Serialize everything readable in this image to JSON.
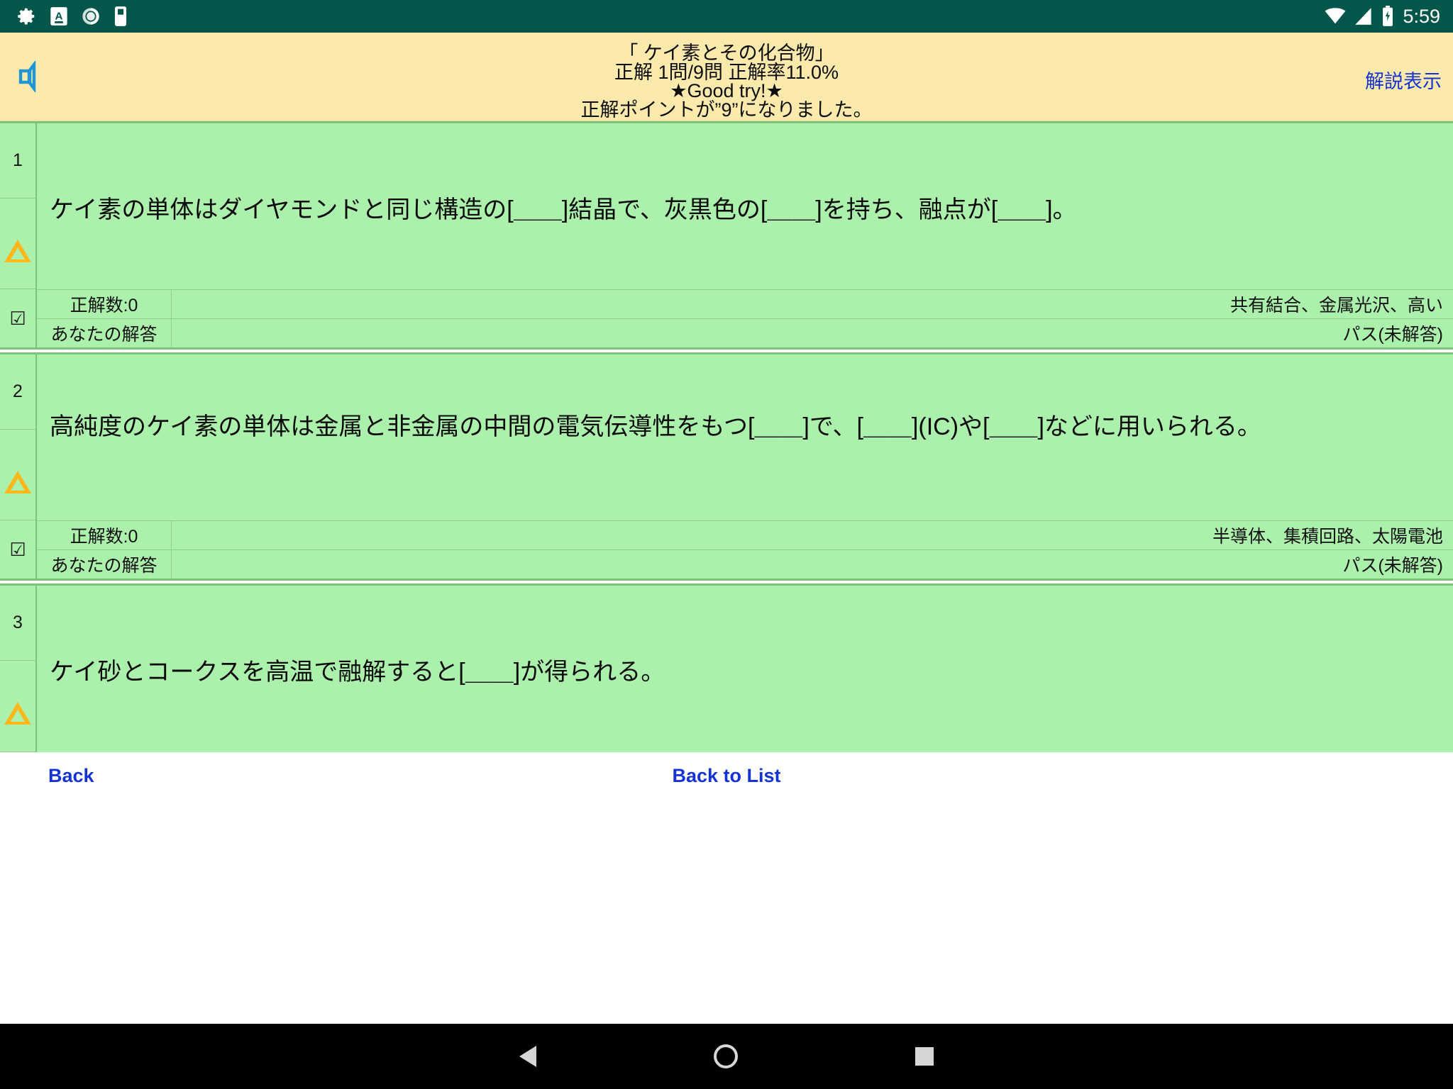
{
  "statusbar": {
    "icons": [
      "gear-icon",
      "a-badge-icon",
      "spinner-icon",
      "sim-card-icon"
    ],
    "right_icons": [
      "wifi-icon",
      "signal-icon",
      "battery-icon"
    ],
    "clock": "5:59",
    "bg_color": "#04564b"
  },
  "header": {
    "speaker_icon": "speaker-mute-icon",
    "title": "「 ケイ素とその化合物」",
    "score_line": "正解 1問/9問  正解率11.0%",
    "encourage_line": "★Good try!★",
    "point_line": "正解ポイントが”9”になりました。",
    "explain_link": "解説表示",
    "bg_color": "#fbeaac",
    "link_color": "#1433d6"
  },
  "questions": [
    {
      "number": "1",
      "mark_icon": "triangle-warning-icon",
      "check_icon": "checkbox-checked-icon",
      "text": "ケイ素の単体はダイヤモンドと同じ構造の[＿＿]結晶で、灰黒色の[＿＿]を持ち、融点が[＿＿]。",
      "correct_count_label": "正解数:0",
      "correct_answer": "共有結合、金属光沢、高い",
      "your_answer_label": "あなたの解答",
      "your_answer": "パス(未解答)"
    },
    {
      "number": "2",
      "mark_icon": "triangle-warning-icon",
      "check_icon": "checkbox-checked-icon",
      "text": "高純度のケイ素の単体は金属と非金属の中間の電気伝導性をもつ[＿＿]で、[＿＿](IC)や[＿＿]などに用いられる。",
      "correct_count_label": "正解数:0",
      "correct_answer": "半導体、集積回路、太陽電池",
      "your_answer_label": "あなたの解答",
      "your_answer": "パス(未解答)"
    },
    {
      "number": "3",
      "mark_icon": "triangle-warning-icon",
      "text": "ケイ砂とコークスを高温で融解すると[＿＿]が得られる。"
    }
  ],
  "footer": {
    "back_label": "Back",
    "back_to_list_label": "Back to List"
  },
  "navbar": {
    "back_icon": "nav-back-triangle-icon",
    "home_icon": "nav-home-circle-icon",
    "recents_icon": "nav-recents-square-icon"
  },
  "colors": {
    "card_bg": "#abf0ab",
    "card_border": "#7cc47c",
    "warning": "#ffb71a",
    "speaker": "#2196d4"
  }
}
